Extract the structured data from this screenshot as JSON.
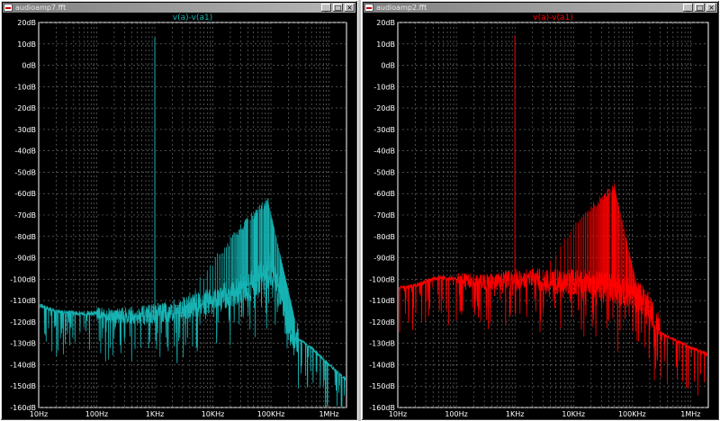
{
  "windows": [
    {
      "title": "audioamp7.fft",
      "controls": [
        "_",
        "□",
        "×"
      ],
      "trace_label": "v(a)-v(a1)",
      "trace_color": "#17b3b3"
    },
    {
      "title": "audioamp2.fft",
      "controls": [
        "_",
        "□",
        "×"
      ],
      "trace_label": "v(a)-v(a1)",
      "trace_color": "#ff0000"
    }
  ],
  "chart_data": [
    {
      "type": "line",
      "title": "v(a)-v(a1)",
      "xlabel": "",
      "ylabel": "",
      "x_scale": "log",
      "xlim": [
        10,
        2000000
      ],
      "ylim": [
        -160,
        20
      ],
      "grid": true,
      "x_tick_labels": [
        "10Hz",
        "100Hz",
        "1KHz",
        "10KHz",
        "100KHz",
        "1MHz"
      ],
      "y_tick_labels": [
        "20dB",
        "10dB",
        "0dB",
        "-10dB",
        "-20dB",
        "-30dB",
        "-40dB",
        "-50dB",
        "-60dB",
        "-70dB",
        "-80dB",
        "-90dB",
        "-100dB",
        "-110dB",
        "-120dB",
        "-130dB",
        "-140dB",
        "-150dB",
        "-160dB"
      ],
      "series": [
        {
          "color": "#17b3b3",
          "noise_floor": {
            "x": [
              10,
              20,
              50,
              100,
              200,
              500,
              1000,
              2000,
              5000,
              10000,
              20000,
              50000,
              80000,
              100000,
              150000,
              200000,
              300000,
              500000,
              1000000,
              2000000
            ],
            "y": [
              -112,
              -115,
              -116,
              -116,
              -117,
              -117,
              -116,
              -115,
              -112,
              -110,
              -107,
              -102,
              -98,
              -95,
              -108,
              -122,
              -128,
              -132,
              -140,
              -147
            ]
          },
          "fundamental": {
            "x": 1000,
            "y": 13
          },
          "harmonic_peak": {
            "x": 90000,
            "y": -64
          }
        }
      ]
    },
    {
      "type": "line",
      "title": "v(a)-v(a1)",
      "xlabel": "",
      "ylabel": "",
      "x_scale": "log",
      "xlim": [
        10,
        2000000
      ],
      "ylim": [
        -160,
        20
      ],
      "grid": true,
      "x_tick_labels": [
        "10Hz",
        "100Hz",
        "1KHz",
        "10KHz",
        "100KHz",
        "1MHz"
      ],
      "y_tick_labels": [
        "20dB",
        "10dB",
        "0dB",
        "-10dB",
        "-20dB",
        "-30dB",
        "-40dB",
        "-50dB",
        "-60dB",
        "-70dB",
        "-80dB",
        "-90dB",
        "-100dB",
        "-110dB",
        "-120dB",
        "-130dB",
        "-140dB",
        "-150dB",
        "-160dB"
      ],
      "series": [
        {
          "color": "#ff0000",
          "noise_floor": {
            "x": [
              10,
              20,
              50,
              100,
              200,
              500,
              1000,
              2000,
              5000,
              10000,
              20000,
              50000,
              100000,
              150000,
              200000,
              250000,
              300000,
              500000,
              1000000,
              2000000
            ],
            "y": [
              -104,
              -103,
              -99,
              -100,
              -101,
              -101,
              -100,
              -100,
              -101,
              -101,
              -102,
              -104,
              -107,
              -110,
              -115,
              -120,
              -125,
              -128,
              -132,
              -135
            ]
          },
          "fundamental": {
            "x": 1000,
            "y": 14
          },
          "harmonic_peak": {
            "x": 50000,
            "y": -57
          }
        }
      ]
    }
  ]
}
